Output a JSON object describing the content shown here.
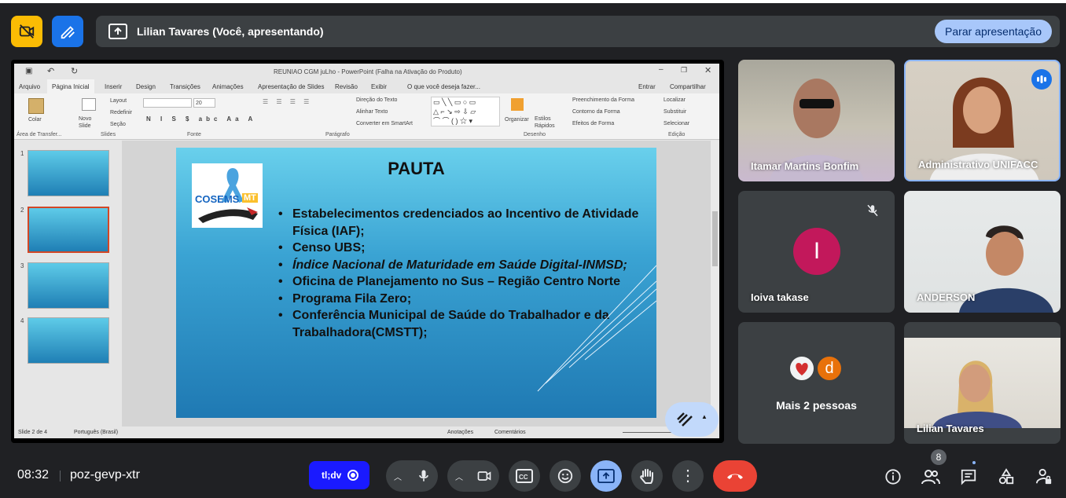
{
  "topbar": {
    "presenting_label": "Lilian Tavares (Você, apresentando)",
    "stop_button": "Parar apresentação"
  },
  "powerpoint": {
    "window_title": "REUNIAO CGM juLho - PowerPoint (Falha na Ativação do Produto)",
    "tabs": [
      "Arquivo",
      "Página Inicial",
      "Inserir",
      "Design",
      "Transições",
      "Animações",
      "Apresentação de Slides",
      "Revisão",
      "Exibir"
    ],
    "tell_me": "O que você deseja fazer...",
    "enter": "Entrar",
    "share": "Compartilhar",
    "ribbon": {
      "paste": "Colar",
      "clipboard": "Área de Transfer...",
      "new_slide": "Novo Slide",
      "layout": "Layout",
      "reset": "Redefinir",
      "section": "Seção",
      "slides": "Slides",
      "font_size": "20",
      "font_group": "Fonte",
      "text_direction": "Direção do Texto",
      "align_text": "Alinhar Texto",
      "smartart": "Converter em SmartArt",
      "paragraph": "Parágrafo",
      "arrange": "Organizar",
      "quick_styles": "Estilos Rápidos",
      "shape_fill": "Preenchimento da Forma",
      "shape_outline": "Contorno da Forma",
      "shape_effects": "Efeitos de Forma",
      "drawing": "Desenho",
      "find": "Localizar",
      "replace": "Substituir",
      "select": "Selecionar",
      "editing": "Edição"
    },
    "thumbnails": [
      "1",
      "2",
      "3",
      "4"
    ],
    "status": {
      "slide": "Slide 2 de 4",
      "language": "Português (Brasil)",
      "notes": "Anotações",
      "comments": "Comentários"
    },
    "slide": {
      "title": "PAUTA",
      "logo_text": "COSEMS",
      "logo_suffix": "MT",
      "bullets": [
        {
          "text": "Estabelecimentos credenciados ao Incentivo de Atividade Física (IAF);",
          "italic": false
        },
        {
          "text": "Censo UBS;",
          "italic": false
        },
        {
          "text": "Índice Nacional de Maturidade em Saúde Digital-INMSD;",
          "italic": true
        },
        {
          "text": "Oficina de Planejamento no Sus – Região Centro Norte",
          "italic": false
        },
        {
          "text": "Programa Fila Zero;",
          "italic": false
        },
        {
          "text": "Conferência Municipal de Saúde do Trabalhador e da Trabalhadora(CMSTT);",
          "italic": false
        }
      ]
    }
  },
  "participants": {
    "p1": "Itamar Martins Bonfim",
    "p2": "Administrativo UNIFACC",
    "p3": "Ioiva takase",
    "p3_initial": "I",
    "p4": "ANDERSON",
    "p5": "Mais 2 pessoas",
    "p5_avatar_letter": "d",
    "p6": "Lilian Tavares"
  },
  "bottombar": {
    "time": "08:32",
    "meeting_code": "poz-gevp-xtr",
    "extension_label": "tl;dv",
    "people_count": "8"
  },
  "colors": {
    "background": "#202124",
    "stop_button": "#a8c7fa",
    "end_call": "#ea4335",
    "present_active": "#8ab4f8",
    "extension": "#1a1aff",
    "avatar_pink": "#c2185b",
    "avatar_orange": "#e8710a"
  }
}
